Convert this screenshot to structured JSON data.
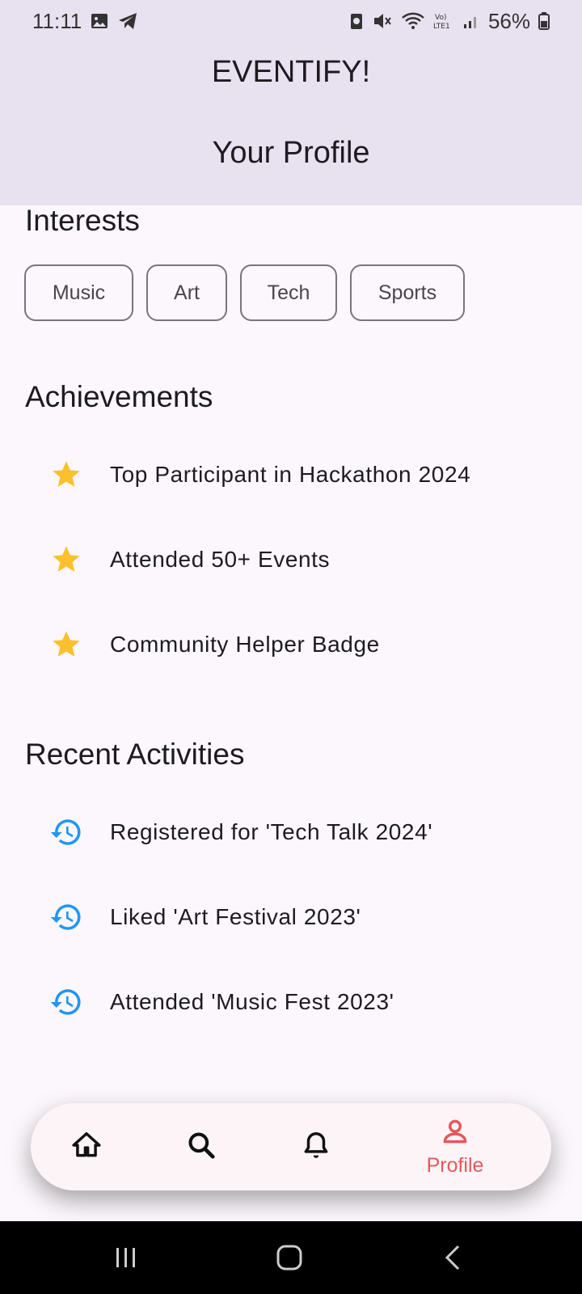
{
  "status_bar": {
    "time": "11:11",
    "battery": "56%",
    "icons": [
      "gallery-icon",
      "telegram-icon",
      "battery-saver-icon",
      "mute-icon",
      "wifi-icon",
      "volte-icon",
      "signal-icon",
      "battery-icon"
    ]
  },
  "header": {
    "app_title": "EVENTIFY!",
    "page_title": "Your Profile",
    "background": "#e8e1f0"
  },
  "interests": {
    "title": "Interests",
    "chips": [
      "Music",
      "Art",
      "Tech",
      "Sports"
    ]
  },
  "achievements": {
    "title": "Achievements",
    "icon": "star-icon",
    "icon_color": "#fbc02d",
    "items": [
      "Top Participant in Hackathon 2024",
      "Attended 50+ Events",
      "Community Helper Badge"
    ]
  },
  "recent_activities": {
    "title": "Recent Activities",
    "icon": "history-icon",
    "icon_color": "#2196f3",
    "items": [
      "Registered for 'Tech Talk 2024'",
      "Liked 'Art Festival 2023'",
      "Attended 'Music Fest 2023'"
    ]
  },
  "bottom_nav": {
    "items": [
      {
        "icon": "home-icon",
        "label": ""
      },
      {
        "icon": "search-icon",
        "label": ""
      },
      {
        "icon": "bell-icon",
        "label": ""
      },
      {
        "icon": "person-icon",
        "label": "Profile",
        "active": true
      }
    ],
    "active_color": "#e35a5a"
  },
  "system_nav": [
    "recents-button",
    "home-button",
    "back-button"
  ]
}
